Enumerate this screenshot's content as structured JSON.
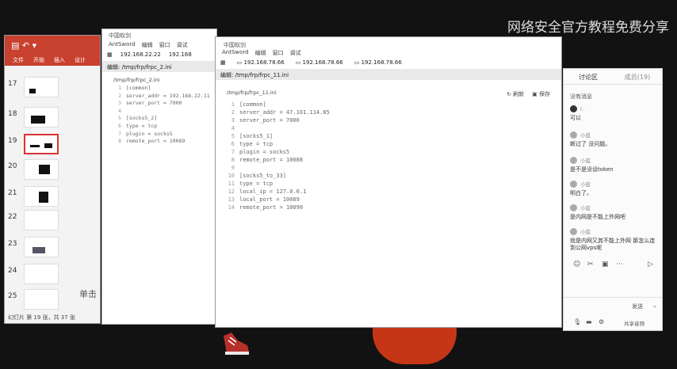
{
  "watermark": "网络安全官方教程免费分享",
  "ppt": {
    "tabs": [
      "文件",
      "开始",
      "插入",
      "设计"
    ],
    "slides": [
      {
        "num": "17"
      },
      {
        "num": "18"
      },
      {
        "num": "19",
        "selected": true
      },
      {
        "num": "20"
      },
      {
        "num": "21"
      },
      {
        "num": "22"
      },
      {
        "num": "23"
      },
      {
        "num": "24"
      },
      {
        "num": "25"
      }
    ],
    "status": "幻灯片 第 19 张，共 37 张",
    "side_text": "单击"
  },
  "win2": {
    "title": "中国蚁剑",
    "menu": [
      "AntSword",
      "编辑",
      "窗口",
      "调试"
    ],
    "tabs": [
      "192.168.22.22",
      "192.168"
    ],
    "editbar": "编辑: /tmp/frp/frpc_2.ini",
    "path": "/tmp/frp/frpc_2.ini",
    "code": [
      {
        "n": "1",
        "t": "[common]"
      },
      {
        "n": "2",
        "t": "server_addr = 192.168.22.11"
      },
      {
        "n": "3",
        "t": "server_port = 7000"
      },
      {
        "n": "4",
        "t": ""
      },
      {
        "n": "5",
        "t": "[socks5_2]"
      },
      {
        "n": "6",
        "t": "type = tcp"
      },
      {
        "n": "7",
        "t": "plugin = socks5"
      },
      {
        "n": "8",
        "t": "remote_port = 10089"
      }
    ]
  },
  "win3": {
    "title": "中国蚁剑",
    "menu": [
      "AntSword",
      "编辑",
      "窗口",
      "调试"
    ],
    "tabs": [
      "192.168.78.66",
      "192.168.78.66",
      "192.168.78.66"
    ],
    "editbar": "编辑: /tmp/frp/frpc_11.ini",
    "path": "/tmp/frp/frpc_11.ini",
    "buttons": [
      "刷新",
      "保存"
    ],
    "code": [
      {
        "n": "1",
        "t": "[common]"
      },
      {
        "n": "2",
        "t": "server_addr = 47.101.114.85"
      },
      {
        "n": "3",
        "t": "server_port = 7000"
      },
      {
        "n": "4",
        "t": ""
      },
      {
        "n": "5",
        "t": "[socks5_1]"
      },
      {
        "n": "6",
        "t": "type = tcp"
      },
      {
        "n": "7",
        "t": "plugin = socks5"
      },
      {
        "n": "8",
        "t": "remote_port = 10088"
      },
      {
        "n": "9",
        "t": ""
      },
      {
        "n": "10",
        "t": "[socks5_to_33]"
      },
      {
        "n": "11",
        "t": "type = tcp"
      },
      {
        "n": "12",
        "t": "local_ip = 127.0.0.1"
      },
      {
        "n": "13",
        "t": "local_port = 10089"
      },
      {
        "n": "14",
        "t": "remote_port = 10090"
      }
    ]
  },
  "chat": {
    "tabs": [
      "讨论区",
      "成员(19)"
    ],
    "notice": "没有消息",
    "messages": [
      {
        "who": "l..",
        "text": "可以"
      },
      {
        "who": "小蓝",
        "text": "断过了 没问题。"
      },
      {
        "who": "小蓝",
        "text": "是不是没设token"
      },
      {
        "who": "小蓝",
        "text": "明白了。"
      },
      {
        "who": "小蓝",
        "text": "是内网是不能上外网吧"
      },
      {
        "who": "小蓝",
        "text": "就是内网又其不能上外网 那怎么连到公网vps呢"
      }
    ],
    "send": "发送",
    "footer": "共享音频"
  }
}
